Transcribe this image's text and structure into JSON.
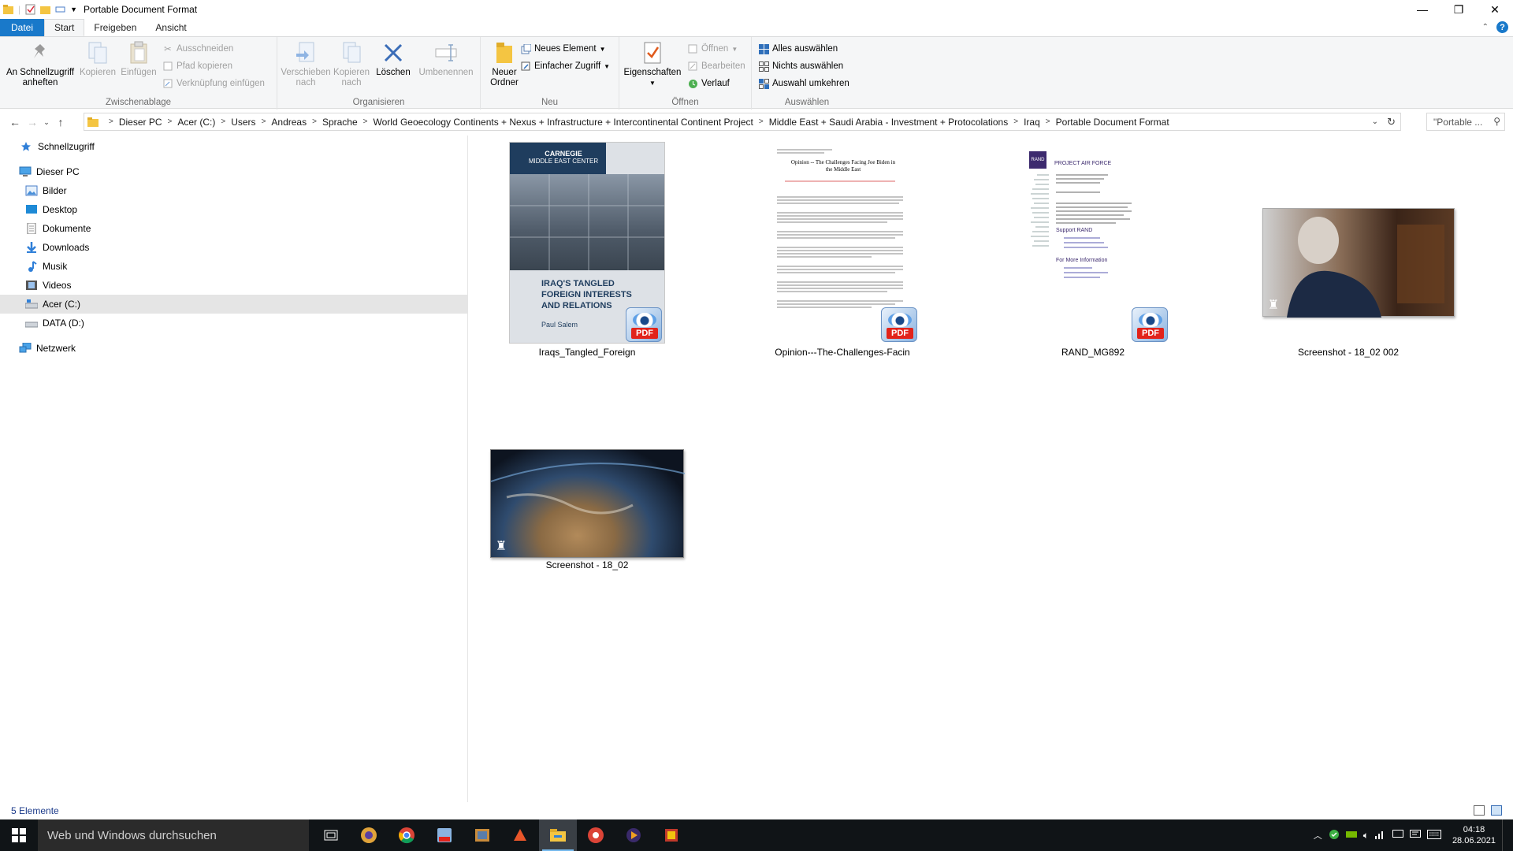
{
  "window": {
    "title": "Portable Document Format",
    "controls": {
      "minimize": "—",
      "maximize": "❐",
      "close": "✕"
    }
  },
  "ribbon_tabs": {
    "file": "Datei",
    "start": "Start",
    "share": "Freigeben",
    "view": "Ansicht"
  },
  "ribbon": {
    "clipboard": {
      "label": "Zwischenablage",
      "pin": "An Schnellzugriff anheften",
      "pin_line1": "An Schnellzugriff",
      "pin_line2": "anheften",
      "copy": "Kopieren",
      "paste": "Einfügen",
      "cut": "Ausschneiden",
      "copy_path": "Pfad kopieren",
      "paste_shortcut": "Verknüpfung einfügen"
    },
    "organize": {
      "label": "Organisieren",
      "move_line1": "Verschieben",
      "move_line2": "nach",
      "copy_line1": "Kopieren",
      "copy_line2": "nach",
      "delete": "Löschen",
      "rename": "Umbenennen"
    },
    "new": {
      "label": "Neu",
      "folder_line1": "Neuer",
      "folder_line2": "Ordner",
      "new_item": "Neues Element",
      "easy_access": "Einfacher Zugriff"
    },
    "open": {
      "label": "Öffnen",
      "properties": "Eigenschaften",
      "open": "Öffnen",
      "edit": "Bearbeiten",
      "history": "Verlauf"
    },
    "select": {
      "label": "Auswählen",
      "select_all": "Alles auswählen",
      "select_none": "Nichts auswählen",
      "invert": "Auswahl umkehren"
    }
  },
  "address": {
    "crumbs": [
      "Dieser PC",
      "Acer (C:)",
      "Users",
      "Andreas",
      "Sprache",
      "World Geoecology Continents + Nexus + Infrastructure + Intercontinental Continent Project",
      "Middle East + Saudi Arabia - Investment + Protocolations",
      "Iraq",
      "Portable Document Format"
    ],
    "search_placeholder": "\"Portable ..."
  },
  "nav": {
    "quick_access": "Schnellzugriff",
    "this_pc": "Dieser PC",
    "pictures": "Bilder",
    "desktop": "Desktop",
    "documents": "Dokumente",
    "downloads": "Downloads",
    "music": "Musik",
    "videos": "Videos",
    "acer": "Acer (C:)",
    "data": "DATA (D:)",
    "network": "Netzwerk"
  },
  "files": {
    "f1": "Iraqs_Tangled_Foreign",
    "f2": "Opinion---The-Challenges-Facin",
    "f3": "RAND_MG892",
    "f4": "Screenshot - 18_02 002",
    "f5": "Screenshot - 18_02"
  },
  "thumbs": {
    "carnegie_org1": "CARNEGIE",
    "carnegie_org2": "MIDDLE EAST CENTER",
    "carnegie_title1": "IRAQ'S TANGLED",
    "carnegie_title2": "FOREIGN INTERESTS",
    "carnegie_title3": "AND RELATIONS",
    "carnegie_author": "Paul Salem",
    "opinion_title": "Opinion -- The Challenges Facing Joe Biden in the Middle East",
    "rand_logo": "RAND",
    "rand_header": "PROJECT AIR FORCE",
    "rand_support": "Support RAND",
    "rand_more": "For More Information",
    "pdf": "PDF"
  },
  "status": {
    "count": "5 Elemente"
  },
  "taskbar": {
    "search_placeholder": "Web und Windows durchsuchen",
    "time": "04:18",
    "date": "28.06.2021"
  },
  "colors": {
    "accent": "#1979ca",
    "ribbon_bg": "#f5f6f7",
    "taskbar_bg": "#101417",
    "selected_nav": "#e5e5e5"
  }
}
